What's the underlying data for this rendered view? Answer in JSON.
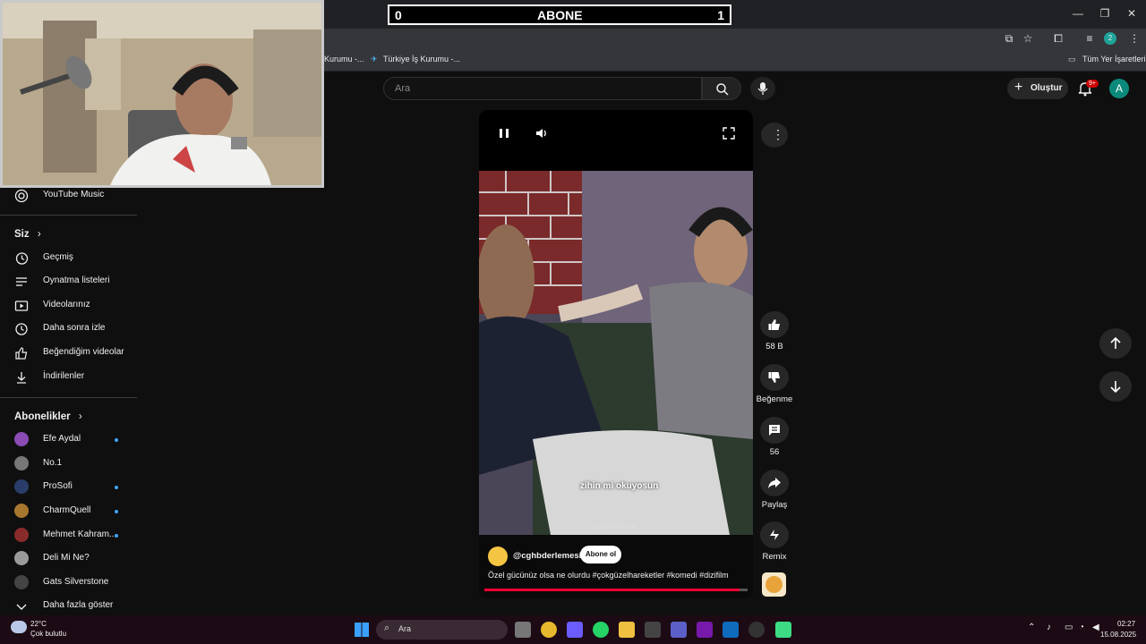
{
  "overlay": {
    "left_count": "0",
    "title": "ABONE",
    "right_count": "1"
  },
  "window": {
    "minimize": "—",
    "maximize": "❐",
    "close": "✕"
  },
  "bookmarks": [
    {
      "label": "Kurumu -..."
    },
    {
      "label": "Türkiye İş Kurumu -..."
    }
  ],
  "bookmarks_all": "Tüm Yer İşaretleri",
  "header": {
    "search_placeholder": "Ara",
    "create_label": "Oluştur",
    "notif_badge": "9+",
    "avatar_letter": "A"
  },
  "sidebar": {
    "music": "YouTube Music",
    "you_heading": "Siz",
    "you_items": [
      {
        "label": "Geçmiş",
        "icon": "history-icon"
      },
      {
        "label": "Oynatma listeleri",
        "icon": "playlist-icon"
      },
      {
        "label": "Videolarınız",
        "icon": "video-icon"
      },
      {
        "label": "Daha sonra izle",
        "icon": "clock-icon"
      },
      {
        "label": "Beğendiğim videolar",
        "icon": "like-icon"
      },
      {
        "label": "İndirilenler",
        "icon": "download-icon"
      }
    ],
    "subs_heading": "Abonelikler",
    "subscriptions": [
      {
        "label": "Efe Aydal",
        "new": true,
        "color": "#8a4bb5"
      },
      {
        "label": "No.1",
        "new": false,
        "color": "#777777"
      },
      {
        "label": "ProSofi",
        "new": true,
        "color": "#2a3d6a"
      },
      {
        "label": "CharmQuell",
        "new": true,
        "color": "#a8772e"
      },
      {
        "label": "Mehmet Kahram...",
        "new": true,
        "color": "#8a2b2b"
      },
      {
        "label": "Deli Mi Ne?",
        "new": false,
        "color": "#9a9a9a"
      },
      {
        "label": "Gats Silverstone",
        "new": false,
        "color": "#444444"
      }
    ],
    "show_more": "Daha fazla göster"
  },
  "short": {
    "caption": "zihin mi okuyosun",
    "watermark": "cghbderlemesi",
    "channel": "@cghbderlemesi",
    "subscribe": "Abone ol",
    "description": "Özel gücünüz olsa ne olurdu #çokgüzelhareketler #komedi #dizifilm",
    "progress": 0.97
  },
  "actions": {
    "like_count": "58 B",
    "dislike": "Beğenme",
    "comment_count": "56",
    "share": "Paylaş",
    "remix": "Remix"
  },
  "taskbar": {
    "temp": "22°C",
    "weather": "Çok bulutlu",
    "search": "Ara",
    "time": "02:27",
    "date": "15.08.2025"
  }
}
